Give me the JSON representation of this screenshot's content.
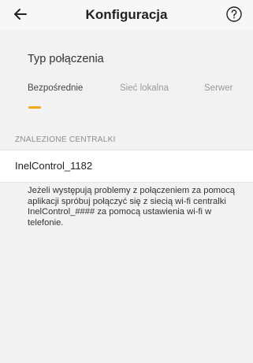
{
  "header": {
    "title": "Konfiguracja",
    "back_icon": "arrow-left-icon",
    "help_icon": "question-circle-icon"
  },
  "connection": {
    "label": "Typ połączenia",
    "tabs": [
      {
        "label": "Bezpośrednie",
        "active": true
      },
      {
        "label": "Sieć lokalna",
        "active": false
      },
      {
        "label": "Serwer",
        "active": false
      }
    ],
    "accent_color": "#f3a81a"
  },
  "found_devices": {
    "header": "ZNALEZIONE CENTRALKI",
    "items": [
      {
        "name": "InelControl_1182"
      }
    ]
  },
  "info_text": "Jeżeli występują problemy z połączeniem za pomocą aplikacji spróbuj połączyć się z siecią wi-fi centralki InelControl_#### za pomocą ustawienia wi-fi w telefonie."
}
